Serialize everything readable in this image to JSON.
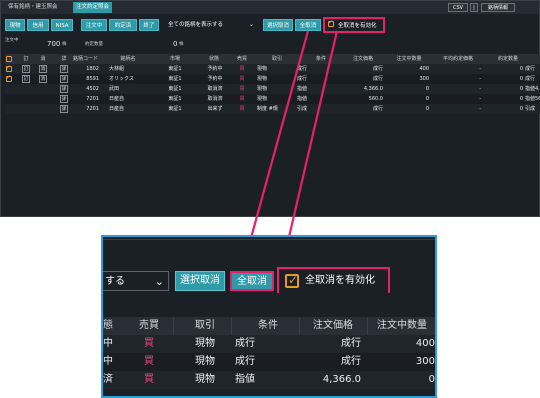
{
  "tabs": [
    "保有銘柄・建玉照会",
    "注文約定照会"
  ],
  "right_buttons": [
    "CSV",
    "|",
    "銘柄情報"
  ],
  "filter_buttons": [
    "現物",
    "信用",
    "NISA",
    "注文中",
    "約定済",
    "終了"
  ],
  "select_value": "全ての銘柄を表示する",
  "select_value_zoom": "する",
  "bulk": {
    "select_cancel": "選択取消",
    "cancel_all": "全取消",
    "enable_cancel_all": "全取消を有効化"
  },
  "summary": {
    "label_orders": "注文中",
    "label_executed": "約定数量",
    "orders_value": "700",
    "orders_unit": "株",
    "executed_value": "0",
    "executed_unit": "株"
  },
  "table": {
    "headers": [
      "",
      "訂",
      "消",
      "詳",
      "銘柄コード",
      "銘柄名",
      "市場",
      "状態",
      "売買",
      "取引",
      "条件",
      "注文価格",
      "注文中数量",
      "平均約定価格",
      "約定数量",
      ""
    ],
    "mini_labels": {
      "edit": "訂",
      "cancel": "消",
      "detail": "詳"
    },
    "rows": [
      {
        "checked": true,
        "edit": true,
        "cancel": true,
        "code": "1802",
        "name": "大林組",
        "market": "東証1",
        "status": "予約中",
        "side": "買",
        "trade": "現物",
        "cond": "成行",
        "price": "成行",
        "qty": "400",
        "avg": "-",
        "exec": "0",
        "tail": "成行"
      },
      {
        "checked": true,
        "edit": true,
        "cancel": true,
        "code": "8591",
        "name": "オリックス",
        "market": "東証1",
        "status": "予約中",
        "side": "買",
        "trade": "現物",
        "cond": "成行",
        "price": "成行",
        "qty": "300",
        "avg": "-",
        "exec": "0",
        "tail": "成行"
      },
      {
        "checked": false,
        "edit": false,
        "cancel": false,
        "code": "4502",
        "name": "武田",
        "market": "東証1",
        "status": "取消済",
        "side": "買",
        "trade": "現物",
        "cond": "指値",
        "price": "4,366.0",
        "qty": "0",
        "avg": "-",
        "exec": "0",
        "tail": "指値4,3"
      },
      {
        "checked": false,
        "edit": false,
        "cancel": false,
        "code": "7201",
        "name": "日産自",
        "market": "東証1",
        "status": "取消済",
        "side": "買",
        "trade": "現物",
        "cond": "指値",
        "price": "560.0",
        "qty": "0",
        "avg": "-",
        "exec": "0",
        "tail": "指値56"
      },
      {
        "checked": false,
        "edit": false,
        "cancel": false,
        "code": "7201",
        "name": "日産自",
        "market": "東証1",
        "status": "出来ず",
        "side": "買",
        "trade": "制度 #規",
        "cond": "引成",
        "price": "成行",
        "qty": "0",
        "avg": "-",
        "exec": "0",
        "tail": "引成"
      }
    ]
  },
  "zoom": {
    "headers": [
      "態",
      "売買",
      "取引",
      "条件",
      "注文価格",
      "注文中数量"
    ],
    "rows": [
      {
        "status": "中",
        "side": "買",
        "trade": "現物",
        "cond": "成行",
        "price": "成行",
        "qty": "400"
      },
      {
        "status": "中",
        "side": "買",
        "trade": "現物",
        "cond": "成行",
        "price": "成行",
        "qty": "300"
      },
      {
        "status": "済",
        "side": "買",
        "trade": "現物",
        "cond": "指値",
        "price": "4,366.0",
        "qty": "0"
      }
    ]
  },
  "colors": {
    "accent": "#2f9aa8",
    "highlight": "#e5216b",
    "check": "#e39a2e",
    "buy": "#e0487e",
    "zoom_border": "#2aa0d6"
  }
}
